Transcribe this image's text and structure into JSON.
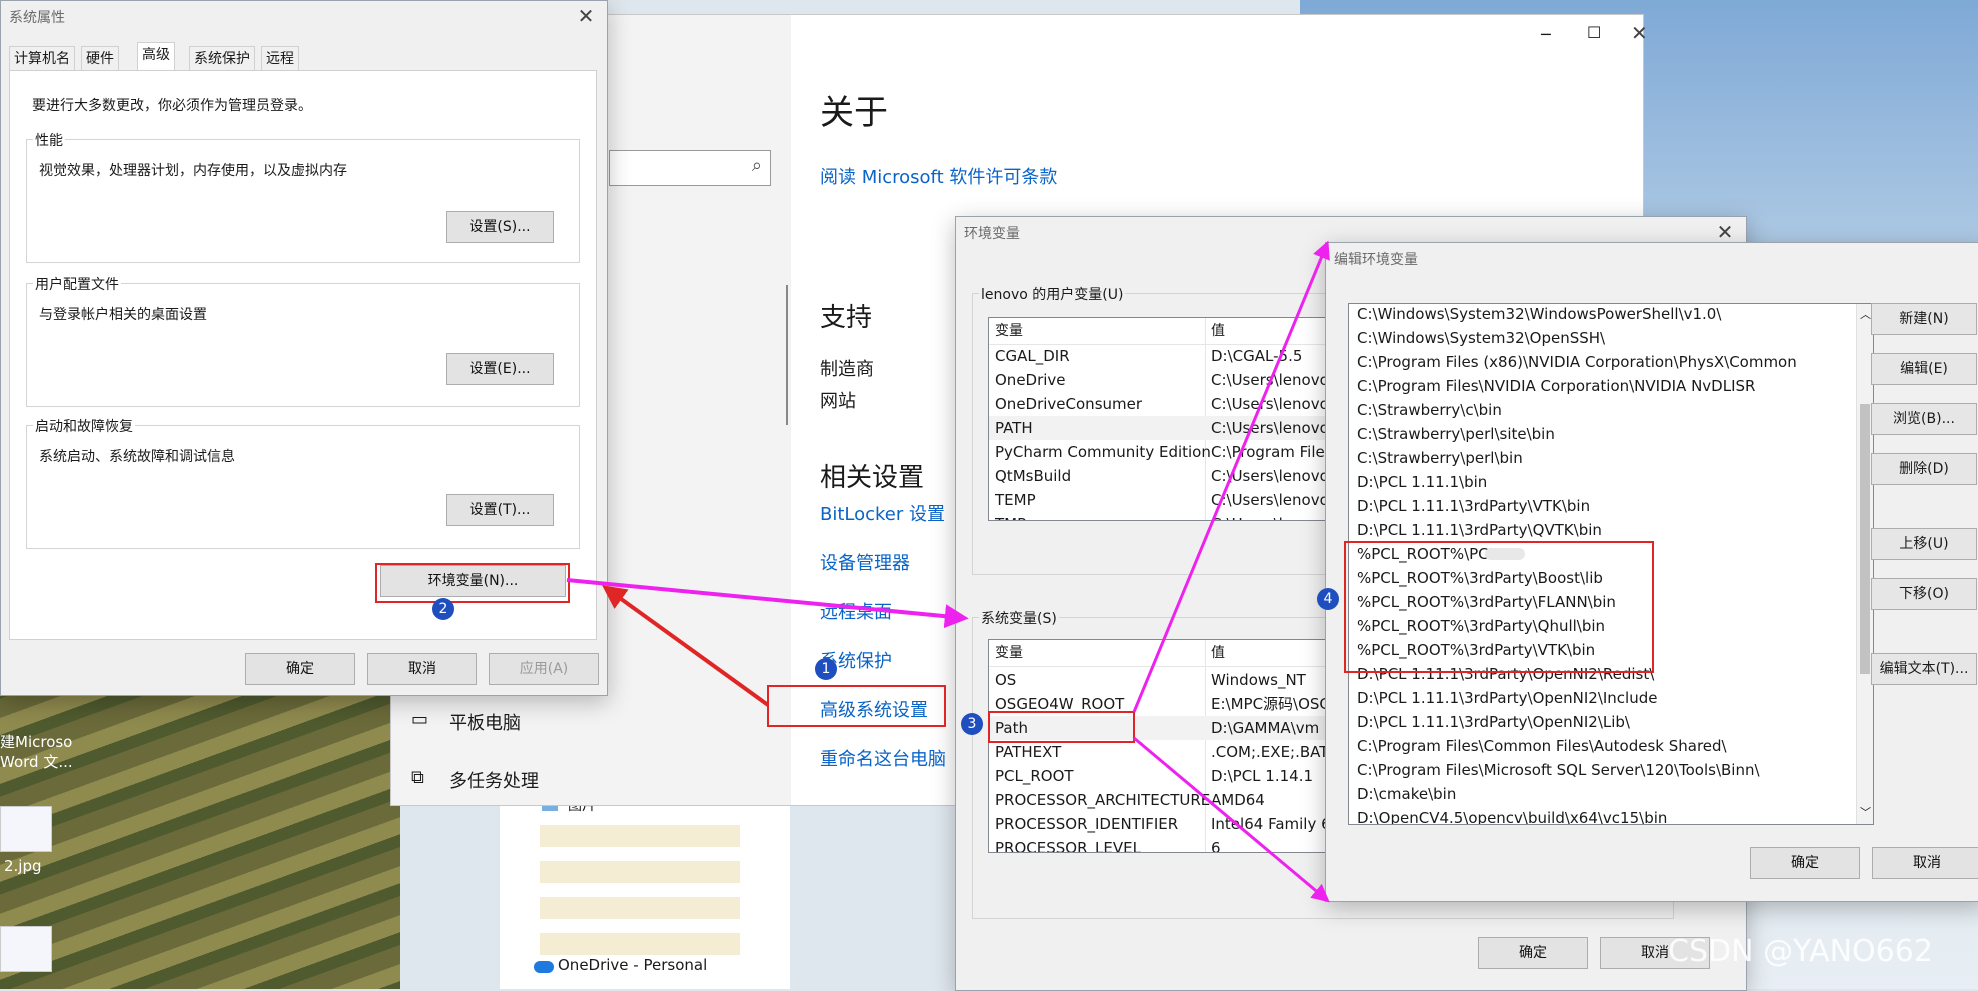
{
  "sys_props": {
    "title": "系统属性",
    "tabs": [
      "计算机名",
      "硬件",
      "高级",
      "系统保护",
      "远程"
    ],
    "admin_note": "要进行大多数更改，你必须作为管理员登录。",
    "perf": {
      "caption": "性能",
      "desc": "视觉效果，处理器计划，内存使用，以及虚拟内存",
      "button": "设置(S)..."
    },
    "profile": {
      "caption": "用户配置文件",
      "desc": "与登录帐户相关的桌面设置",
      "button": "设置(E)..."
    },
    "startup": {
      "caption": "启动和故障恢复",
      "desc": "系统启动、系统故障和调试信息",
      "button": "设置(T)..."
    },
    "env_button": "环境变量(N)...",
    "ok": "确定",
    "cancel": "取消",
    "apply": "应用(A)"
  },
  "about": {
    "heading": "关于",
    "license_link": "阅读 Microsoft 软件许可条款",
    "support_heading": "支持",
    "manufacturer": "制造商",
    "website": "网站",
    "related_heading": "相关设置",
    "links": [
      "BitLocker 设置",
      "设备管理器",
      "远程桌面",
      "系统保护",
      "高级系统设置",
      "重命名这台电脑"
    ]
  },
  "settings_menu": {
    "tablet": "平板电脑",
    "multitask": "多任务处理"
  },
  "explorer": {
    "pictures": "图片",
    "onedrive": "OneDrive - Personal"
  },
  "desktop": {
    "word_label": "建Microso\nWord 文...",
    "jpg_label": "2.jpg"
  },
  "env_vars": {
    "title": "环境变量",
    "user_caption": "lenovo 的用户变量(U)",
    "col_var": "变量",
    "col_val": "值",
    "user_rows": [
      [
        "CGAL_DIR",
        "D:\\CGAL-5.5"
      ],
      [
        "OneDrive",
        "C:\\Users\\lenovo"
      ],
      [
        "OneDriveConsumer",
        "C:\\Users\\lenovo"
      ],
      [
        "PATH",
        "C:\\Users\\lenovo"
      ],
      [
        "PyCharm Community Edition",
        "C:\\Program Files"
      ],
      [
        "QtMsBuild",
        "C:\\Users\\lenovo"
      ],
      [
        "TEMP",
        "C:\\Users\\lenovo"
      ],
      [
        "TMP",
        "C:\\Users\\lenovo"
      ]
    ],
    "sys_caption": "系统变量(S)",
    "sys_rows": [
      [
        "OS",
        "Windows_NT"
      ],
      [
        "OSGEO4W_ROOT",
        "E:\\MPC源码\\OSG"
      ],
      [
        "Path",
        "D:\\GAMMA\\vm"
      ],
      [
        "PATHEXT",
        ".COM;.EXE;.BAT"
      ],
      [
        "PCL_ROOT",
        "D:\\PCL 1.14.1"
      ],
      [
        "PROCESSOR_ARCHITECTURE",
        "AMD64"
      ],
      [
        "PROCESSOR_IDENTIFIER",
        "Intel64 Family 6"
      ],
      [
        "PROCESSOR_LEVEL",
        "6"
      ]
    ],
    "ok": "确定",
    "cancel": "取消"
  },
  "edit_env": {
    "title": "编辑环境变量",
    "paths": [
      "C:\\Windows\\System32\\WindowsPowerShell\\v1.0\\",
      "C:\\Windows\\System32\\OpenSSH\\",
      "C:\\Program Files (x86)\\NVIDIA Corporation\\PhysX\\Common",
      "C:\\Program Files\\NVIDIA Corporation\\NVIDIA NvDLISR",
      "C:\\Strawberry\\c\\bin",
      "C:\\Strawberry\\perl\\site\\bin",
      "C:\\Strawberry\\perl\\bin",
      "D:\\PCL 1.11.1\\bin",
      "D:\\PCL 1.11.1\\3rdParty\\VTK\\bin",
      "D:\\PCL 1.11.1\\3rdParty\\QVTK\\bin",
      "%PCL_ROOT%\\PCL",
      "%PCL_ROOT%\\3rdParty\\Boost\\lib",
      "%PCL_ROOT%\\3rdParty\\FLANN\\bin",
      "%PCL_ROOT%\\3rdParty\\Qhull\\bin",
      "%PCL_ROOT%\\3rdParty\\VTK\\bin",
      "D:\\PCL 1.11.1\\3rdParty\\OpenNI2\\Redist\\",
      "D:\\PCL 1.11.1\\3rdParty\\OpenNI2\\Include",
      "D:\\PCL 1.11.1\\3rdParty\\OpenNI2\\Lib\\",
      "C:\\Program Files\\Common Files\\Autodesk Shared\\",
      "C:\\Program Files\\Microsoft SQL Server\\120\\Tools\\Binn\\",
      "D:\\cmake\\bin",
      "D:\\OpenCV4.5\\opencv\\build\\x64\\vc15\\bin"
    ],
    "buttons": [
      "新建(N)",
      "编辑(E)",
      "浏览(B)...",
      "删除(D)",
      "上移(U)",
      "下移(O)",
      "编辑文本(T)..."
    ],
    "ok": "确定",
    "cancel": "取消"
  },
  "steps": [
    "1",
    "2",
    "3",
    "4"
  ],
  "watermark": "CSDN @YANO662",
  "colors": {
    "annotation_red": "#e02525",
    "arrow_magenta": "#ee22ee",
    "badge_blue": "#1f4fbf",
    "link_blue": "#0a64c8"
  }
}
